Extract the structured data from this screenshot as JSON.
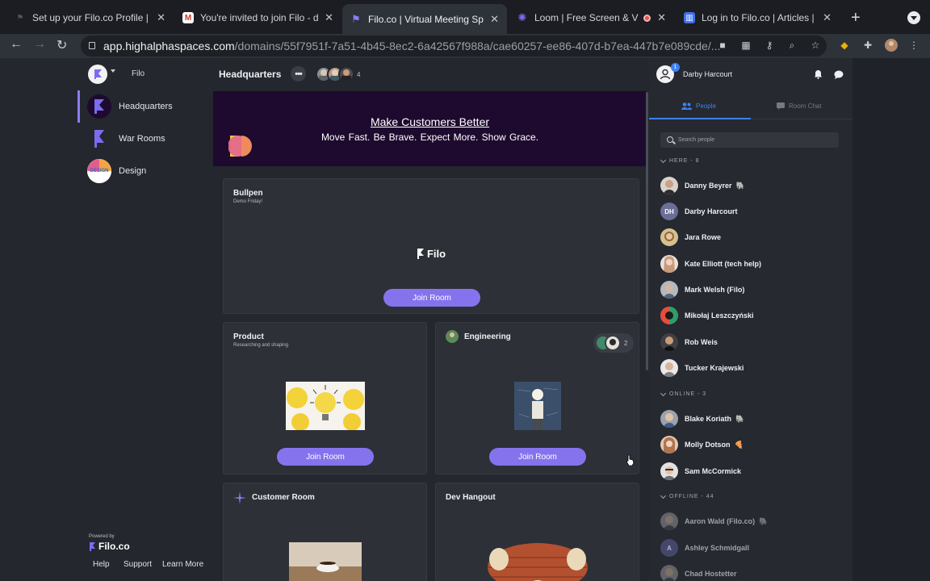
{
  "browser": {
    "tabs": [
      {
        "title": "Set up your Filo.co Profile | Fi",
        "favicon": "filo-faded-icon"
      },
      {
        "title": "You're invited to join Filo - da",
        "favicon": "gmail-icon"
      },
      {
        "title": "Filo.co | Virtual Meeting Spac",
        "favicon": "filo-icon",
        "active": true
      },
      {
        "title": "Loom | Free Screen & Vid",
        "favicon": "loom-icon",
        "recording": true
      },
      {
        "title": "Log in to Filo.co | Articles | A",
        "favicon": "intercom-icon"
      }
    ],
    "url_host": "app.highalphaspaces.com",
    "url_path": "/domains/55f7951f-7a51-4b45-8ec2-6a42567f988a/cae60257-ee86-407d-b7ea-447b7e089cde/..."
  },
  "workspace": {
    "name": "Filo",
    "nav": [
      {
        "label": "Headquarters",
        "icon": "filo-flag-icon",
        "active": true
      },
      {
        "label": "War Rooms",
        "icon": "filo-flag-icon"
      },
      {
        "label": "Design",
        "icon": "design-badge-icon",
        "badge": "DESIGN"
      }
    ],
    "powered_by": "Powered by",
    "brand": "Filo.co",
    "footer_links": [
      "Help",
      "Support",
      "Learn More"
    ]
  },
  "main": {
    "title": "Headquarters",
    "participant_count": "4",
    "banner": {
      "title": "Make Customers Better",
      "subtitle": "Move Fast.  Be Brave.  Expect More.  Show Grace."
    },
    "rooms": {
      "bullpen": {
        "title": "Bullpen",
        "subtitle": "Demo Friday!",
        "logo_text": "Filo",
        "join": "Join Room"
      },
      "product": {
        "title": "Product",
        "subtitle": "Researching and shaping",
        "join": "Join Room"
      },
      "engineering": {
        "title": "Engineering",
        "participant_count": "2",
        "join": "Join Room"
      },
      "customer": {
        "title": "Customer Room"
      },
      "dev": {
        "title": "Dev Hangout"
      }
    }
  },
  "right": {
    "user_name": "Darby Harcourt",
    "notification_count": "1",
    "tabs": {
      "people": "People",
      "room_chat": "Room Chat"
    },
    "search_placeholder": "Search people",
    "groups": {
      "here": "HERE - 8",
      "online": "ONLINE - 3",
      "offline": "OFFLINE - 44"
    },
    "here": [
      {
        "name": "Danny Beyrer",
        "emoji": "🐘"
      },
      {
        "name": "Darby Harcourt",
        "initials": "DH"
      },
      {
        "name": "Jara Rowe"
      },
      {
        "name": "Kate Elliott (tech help)"
      },
      {
        "name": "Mark Welsh (Filo)"
      },
      {
        "name": "Mikołaj Leszczyński"
      },
      {
        "name": "Rob Weis"
      },
      {
        "name": "Tucker Krajewski"
      }
    ],
    "online": [
      {
        "name": "Blake Koriath",
        "emoji": "🐘"
      },
      {
        "name": "Molly Dotson",
        "emoji": "🍕"
      },
      {
        "name": "Sam McCormick"
      }
    ],
    "offline": [
      {
        "name": "Aaron Wald (Filo.co)",
        "emoji": "🐘"
      },
      {
        "name": "Ashley Schmidgall",
        "initials": "A"
      },
      {
        "name": "Chad Hostetter"
      }
    ]
  },
  "colors": {
    "accent": "#8573ee",
    "banner": "#1e0a2e",
    "link_blue": "#3b82f6"
  }
}
